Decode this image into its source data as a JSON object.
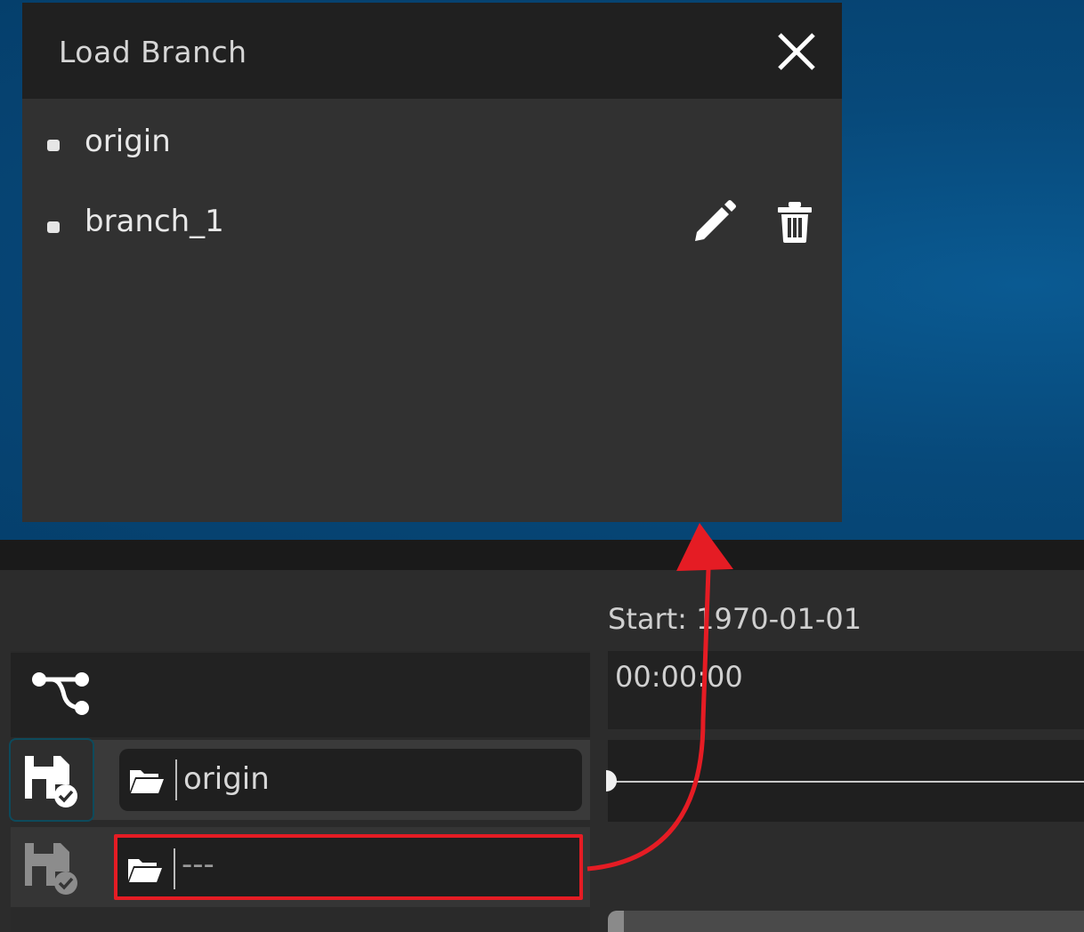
{
  "dialog": {
    "title": "Load Branch",
    "branches": [
      {
        "label": "origin"
      },
      {
        "label": "branch_1"
      }
    ]
  },
  "timeline": {
    "start_label": "Start: 1970-01-01",
    "time_label": "00:00:00"
  },
  "rows": [
    {
      "value": "origin"
    },
    {
      "value": "---"
    }
  ],
  "icons": {
    "close": "close-icon",
    "edit": "pencil-icon",
    "delete": "trash-icon",
    "branch": "branch-icon",
    "save": "save-check-icon",
    "folder": "folder-open-icon"
  },
  "colors": {
    "highlight": "#e51c24",
    "desktop": "#07497a",
    "dialog_bg": "#313131"
  }
}
